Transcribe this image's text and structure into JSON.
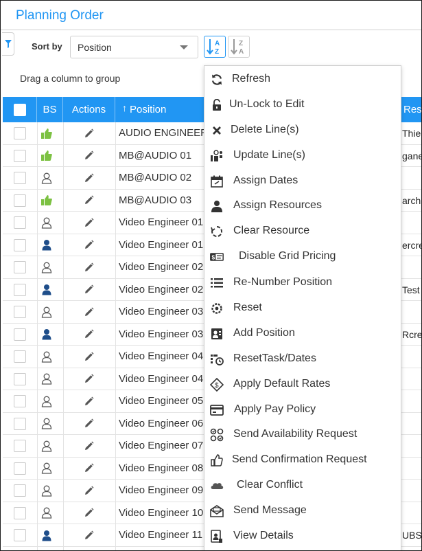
{
  "header": {
    "title": "Planning Order"
  },
  "toolbar": {
    "sort_by_label": "Sort by",
    "sort_value": "Position",
    "sort_asc_icon": "sort-alpha-asc-icon",
    "sort_desc_icon": "sort-alpha-desc-icon",
    "filter_icon": "filter-icon"
  },
  "group_hint": "Drag a column to group",
  "grid": {
    "columns": {
      "bs": "BS",
      "actions": "Actions",
      "position": "Position",
      "resource": "Reso"
    },
    "rows": [
      {
        "bs": "thumbs-up",
        "position": "AUDIO ENGINEER",
        "resource": "Thie"
      },
      {
        "bs": "thumbs-up",
        "position": "MB@AUDIO 01",
        "resource": "gane"
      },
      {
        "bs": "user-outline",
        "position": "MB@AUDIO 02",
        "resource": ""
      },
      {
        "bs": "thumbs-up",
        "position": "MB@AUDIO 03",
        "resource": "arch"
      },
      {
        "bs": "user-outline",
        "position": "Video Engineer 01",
        "resource": ""
      },
      {
        "bs": "user-solid",
        "position": "Video Engineer 01",
        "resource": "ercre"
      },
      {
        "bs": "user-outline",
        "position": "Video Engineer 02",
        "resource": ""
      },
      {
        "bs": "user-solid",
        "position": "Video Engineer 02",
        "resource": "Test"
      },
      {
        "bs": "user-outline",
        "position": "Video Engineer 03",
        "resource": ""
      },
      {
        "bs": "user-solid",
        "position": "Video Engineer 03",
        "resource": "Rcre"
      },
      {
        "bs": "user-outline",
        "position": "Video Engineer 04",
        "resource": ""
      },
      {
        "bs": "user-outline",
        "position": "Video Engineer 04",
        "resource": ""
      },
      {
        "bs": "user-outline",
        "position": "Video Engineer 05",
        "resource": ""
      },
      {
        "bs": "user-outline",
        "position": "Video Engineer 06",
        "resource": ""
      },
      {
        "bs": "user-outline",
        "position": "Video Engineer 07",
        "resource": ""
      },
      {
        "bs": "user-outline",
        "position": "Video Engineer 08",
        "resource": ""
      },
      {
        "bs": "user-outline",
        "position": "Video Engineer 09",
        "resource": ""
      },
      {
        "bs": "user-outline",
        "position": "Video Engineer 10",
        "resource": ""
      },
      {
        "bs": "user-solid",
        "position": "Video Engineer 11",
        "resource": "UBS"
      }
    ]
  },
  "context_menu": {
    "items": [
      {
        "label": "Refresh",
        "icon": "refresh-icon"
      },
      {
        "label": "Un-Lock to Edit",
        "icon": "unlock-icon"
      },
      {
        "label": "Delete Line(s)",
        "icon": "close-icon"
      },
      {
        "label": "Update Line(s)",
        "icon": "update-lines-icon"
      },
      {
        "label": "Assign Dates",
        "icon": "calendar-icon"
      },
      {
        "label": "Assign Resources",
        "icon": "user-assign-icon"
      },
      {
        "label": "Clear Resource",
        "icon": "clear-circle-icon"
      },
      {
        "label": "Disable Grid Pricing",
        "icon": "price-tag-icon"
      },
      {
        "label": "Re-Number Position",
        "icon": "numbered-list-icon"
      },
      {
        "label": "Reset",
        "icon": "reset-gear-icon"
      },
      {
        "label": "Add Position",
        "icon": "contact-card-icon"
      },
      {
        "label": "ResetTask/Dates",
        "icon": "reset-task-icon"
      },
      {
        "label": "Apply Default Rates",
        "icon": "money-tag-icon"
      },
      {
        "label": "Apply Pay Policy",
        "icon": "credit-card-icon"
      },
      {
        "label": "Send Availability Request",
        "icon": "availability-icon"
      },
      {
        "label": "Send Confirmation Request",
        "icon": "thumbs-up-icon"
      },
      {
        "label": "Clear Conflict",
        "icon": "cloud-icon"
      },
      {
        "label": "Send Message",
        "icon": "envelope-icon"
      },
      {
        "label": "View Details",
        "icon": "details-icon"
      }
    ]
  },
  "colors": {
    "accent": "#2196f3",
    "thumbs_green": "#7cc142",
    "user_blue": "#1f4e8a"
  }
}
